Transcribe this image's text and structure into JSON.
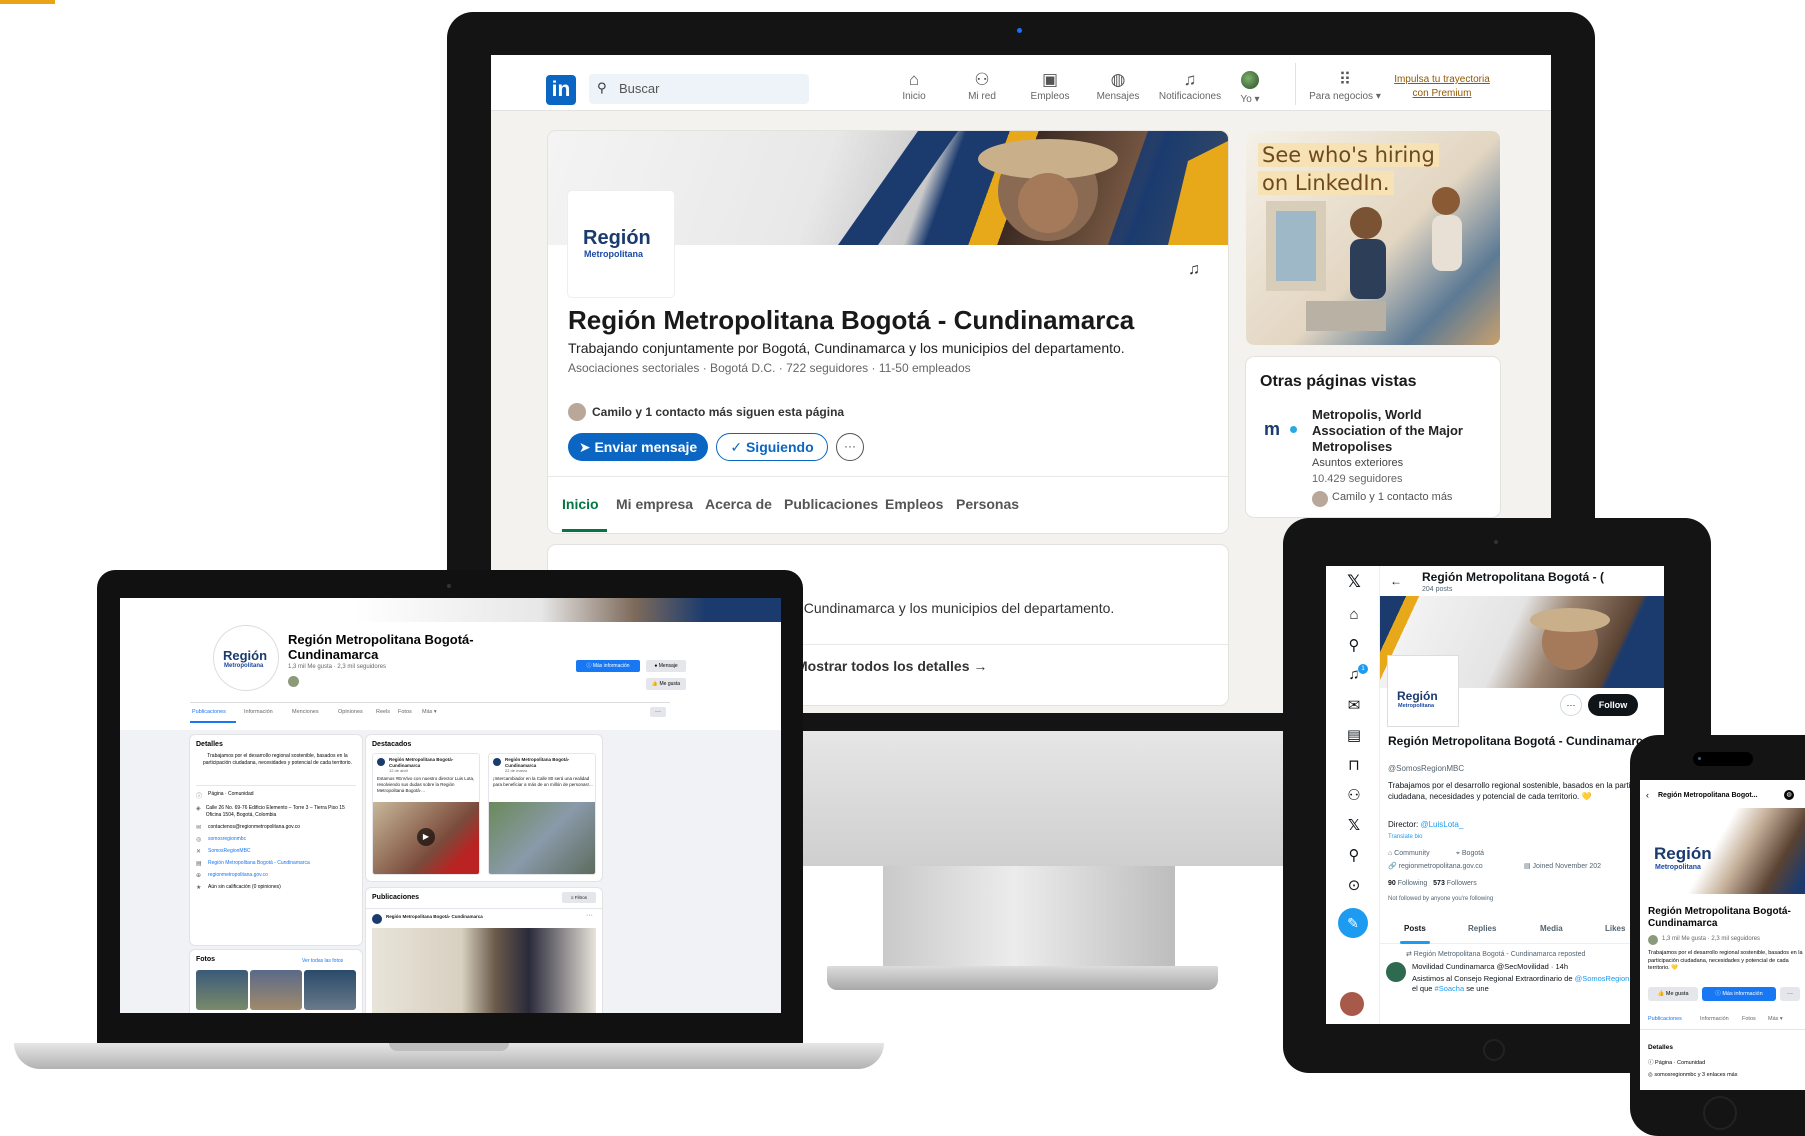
{
  "linkedin": {
    "logo": "in",
    "search_placeholder": "Buscar",
    "nav": [
      {
        "label": "Inicio",
        "icon": "home-icon",
        "glyph": "🏠"
      },
      {
        "label": "Mi red",
        "icon": "network-icon",
        "glyph": "👥"
      },
      {
        "label": "Empleos",
        "icon": "briefcase-icon",
        "glyph": "💼"
      },
      {
        "label": "Mensajes",
        "icon": "messages-icon",
        "glyph": "💬"
      },
      {
        "label": "Notificaciones",
        "icon": "bell-icon",
        "glyph": "🔔"
      },
      {
        "label": "Yo ▾",
        "icon": "avatar",
        "glyph": "●"
      },
      {
        "label": "Para negocios ▾",
        "icon": "apps-grid-icon",
        "glyph": "⋮⋮⋮"
      }
    ],
    "premium_line1": "Impulsa tu trayectoria",
    "premium_line2": "con Premium",
    "brand_word": "Región",
    "brand_sub": "Metropolitana",
    "company_name": "Región Metropolitana Bogotá - Cundinamarca",
    "tagline": "Trabajando conjuntamente por Bogotá, Cundinamarca y los municipios del departamento.",
    "meta": "Asociaciones sectoriales · Bogotá D.C. · 722 seguidores · 11-50 empleados",
    "followers_note": "Camilo y 1 contacto más siguen esta página",
    "btn_message": "➤ Enviar mensaje",
    "btn_following": "✓ Siguiendo",
    "btn_more": "···",
    "tabs": [
      "Inicio",
      "Mi empresa",
      "Acerca de",
      "Publicaciones",
      "Empleos",
      "Personas"
    ],
    "about_text": ", Cundinamarca y los municipios del departamento.",
    "show_details": "Mostrar todos los detalles →",
    "ad_line1": "See who's hiring",
    "ad_line2": "on LinkedIn.",
    "other_pages_title": "Otras páginas vistas",
    "other_logo": "m",
    "other_name": "Metropolis, World Association of the Major Metropolises",
    "other_industry": "Asuntos exteriores",
    "other_followers": "10.429 seguidores",
    "other_follow_note": "Camilo y 1 contacto más"
  },
  "facebook": {
    "page_name": "Región Metropolitana Bogotá-Cundinamarca",
    "stats": "1,3 mil Me gusta · 2,3 mil seguidores",
    "btn_more_info": "ⓘ Más información",
    "btn_message": "● Mensaje",
    "btn_like": "👍 Me gusta",
    "tabs": [
      "Publicaciones",
      "Información",
      "Menciones",
      "Opiniones",
      "Reels",
      "Fotos",
      "Más ▾"
    ],
    "details_title": "Detalles",
    "details_bio": "Trabajamos por el desarrollo regional sostenible, basados en la participación ciudadana, necesidades y potencial de cada territorio.",
    "details_rows": [
      "Página · Comunidad",
      "Calle 26 No. 69-76 Edificio Elemento – Torre 3 – Tierra Piso 15 Oficina 1504, Bogotá, Colombia",
      "contactenos@regionmetropolitana.gov.co",
      "somosregionmbc",
      "SomosRegionMBC",
      "Región Metropolitana Bogotá - Cundinamarca",
      "regionmetropolitana.gov.co",
      "Aún sin calificación (0 opiniones)"
    ],
    "featured_title": "Destacados",
    "featured": [
      {
        "author": "Región Metropolitana Bogotá-Cundinamarca",
        "date": "12 de abril",
        "text": "Estamos #EnVivo con nuestro director Luis Lota, resolviendo sus dudas sobre la Región Metropolitana Bogotá-..."
      },
      {
        "author": "Región Metropolitana Bogotá-Cundinamarca",
        "date": "22 de marzo",
        "text": "¡Intercambiador en la Calle 80 será una realidad para beneficiar a más de un millón de personas!..."
      }
    ],
    "posts_title": "Publicaciones",
    "filters": "≡ Filtros",
    "post_author": "Región Metropolitana Bogotá- Cundinamarca",
    "photos_title": "Fotos",
    "photos_link": "Ver todas las fotos"
  },
  "x": {
    "title": "Región Metropolitana Bogotá - (",
    "posts_count": "204 posts",
    "follow": "Follow",
    "name": "Región Metropolitana Bogotá - Cundinamarca",
    "handle": "@SomosRegionMBC",
    "bio": "Trabajamos por el desarrollo regional sostenible, basados en la participación ciudadana, necesidades y potencial de cada territorio. 💛",
    "director_label": "Director: ",
    "director_handle": "@LuisLota_",
    "translate": "Translate bio",
    "community": "⌂ Community",
    "location": "⌖ Bogotá",
    "website": "🔗 regionmetropolitana.gov.co",
    "joined": "▤ Joined November 202",
    "following_count": "90",
    "following_label": " Following",
    "followers_count": "573",
    "followers_label": " Followers",
    "not_followed": "Not followed by anyone you're following",
    "tabs": [
      "Posts",
      "Replies",
      "Media",
      "Likes"
    ],
    "repost_note": "⇄ Región Metropolitana Bogotá - Cundinamarca reposted",
    "tweet_head": "Movilidad Cundinamarca @SecMovilidad · 14h",
    "tweet_body_1": "Asistimos al Consejo Regional Extraordinario de ",
    "tweet_body_handle": "@SomosRegionMBC",
    "tweet_body_2": ", en el que ",
    "tweet_body_tag": "#Soacha",
    "tweet_body_3": " se une",
    "badge": "1"
  },
  "phone": {
    "title": "Región Metropolitana Bogot...",
    "name": "Región Metropolitana Bogotá-Cundinamarca",
    "stats": "1,3 mil Me gusta · 2,3 mil seguidores",
    "bio": "Trabajamos por el desarrollo regional sostenible, basados en la participación ciudadana, necesidades y potencial de cada territorio. 💛",
    "btn_like": "👍 Me gusta",
    "btn_info": "ⓘ Más información",
    "tabs": [
      "Publicaciones",
      "Información",
      "Fotos",
      "Más ▾"
    ],
    "details": "Detalles",
    "row1": "ⓘ Página · Comunidad",
    "row2": "◎ somosregionmbc y 3 enlaces más"
  },
  "colors": {
    "linkedin_blue": "#0a66c2",
    "linkedin_green": "#057642",
    "facebook_blue": "#1877f2",
    "x_blue": "#1d9bf0",
    "brand_navy": "#1b3b6f",
    "brand_gold": "#e7a91a"
  }
}
